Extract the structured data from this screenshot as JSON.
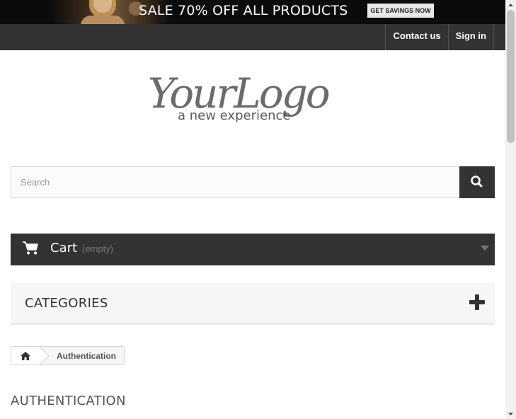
{
  "banner": {
    "text": "SALE 70% OFF ALL PRODUCTS",
    "button_label": "GET SAVINGS NOW"
  },
  "nav": {
    "links": [
      {
        "label": "Contact us"
      },
      {
        "label": "Sign in"
      }
    ]
  },
  "logo": {
    "main": "YourLogo",
    "tagline": "a new experience"
  },
  "search": {
    "placeholder": "Search",
    "value": "",
    "icon": "search-icon"
  },
  "cart": {
    "label": "Cart",
    "status": "(empty)",
    "icon": "shopping-cart-icon"
  },
  "categories": {
    "title": "CATEGORIES",
    "icon": "plus-icon"
  },
  "breadcrumb": {
    "home_icon": "home-icon",
    "current": "Authentication"
  },
  "page": {
    "heading": "AUTHENTICATION"
  },
  "colors": {
    "dark": "#333333",
    "panel": "#f6f6f6",
    "border": "#d6d4d4"
  }
}
